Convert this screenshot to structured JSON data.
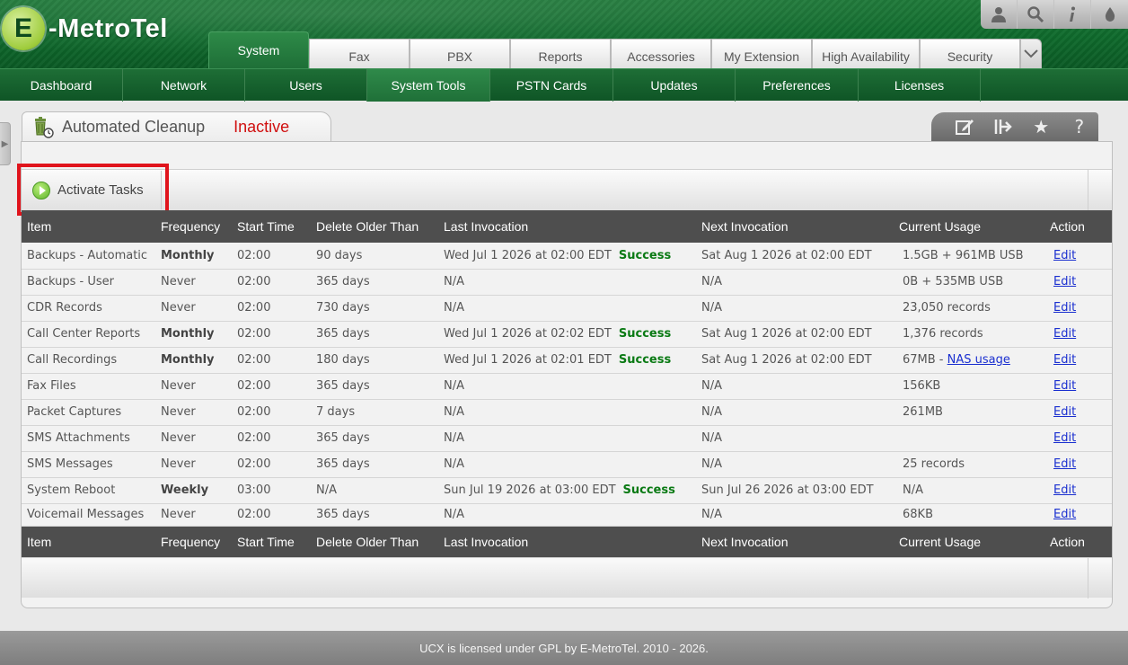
{
  "brand": {
    "logo_letter": "E",
    "logo_text": "-MetroTel"
  },
  "top_icons": [
    "user-icon",
    "search-icon",
    "info-icon",
    "drop-icon"
  ],
  "tabs": [
    {
      "label": "System",
      "active": true
    },
    {
      "label": "Fax"
    },
    {
      "label": "PBX"
    },
    {
      "label": "Reports"
    },
    {
      "label": "Accessories"
    },
    {
      "label": "My Extension"
    },
    {
      "label": "High Availability"
    },
    {
      "label": "Security"
    }
  ],
  "subnav": [
    {
      "label": "Dashboard"
    },
    {
      "label": "Network"
    },
    {
      "label": "Users"
    },
    {
      "label": "System Tools",
      "active": true
    },
    {
      "label": "PSTN Cards"
    },
    {
      "label": "Updates"
    },
    {
      "label": "Preferences"
    },
    {
      "label": "Licenses"
    }
  ],
  "page": {
    "title": "Automated Cleanup",
    "status": "Inactive",
    "status_color": "#d01010"
  },
  "toolbar": {
    "activate_label": "Activate Tasks"
  },
  "table": {
    "headers": [
      "Item",
      "Frequency",
      "Start Time",
      "Delete Older Than",
      "Last Invocation",
      "Next Invocation",
      "Current Usage",
      "Action"
    ],
    "rows": [
      {
        "item": "Backups - Automatic",
        "frequency": "Monthly",
        "freq_bold": true,
        "start": "02:00",
        "older": "90 days",
        "last": "Wed Jul 1 2026 at 02:00 EDT",
        "last_status": "Success",
        "next": "Sat Aug 1 2026 at 02:00 EDT",
        "usage": "1.5GB + 961MB USB",
        "action": "Edit"
      },
      {
        "item": "Backups - User",
        "frequency": "Never",
        "start": "02:00",
        "older": "365 days",
        "last": "N/A",
        "next": "N/A",
        "usage": "0B + 535MB USB",
        "action": "Edit"
      },
      {
        "item": "CDR Records",
        "frequency": "Never",
        "start": "02:00",
        "older": "730 days",
        "last": "N/A",
        "next": "N/A",
        "usage": "23,050 records",
        "action": "Edit"
      },
      {
        "item": "Call Center Reports",
        "frequency": "Monthly",
        "freq_bold": true,
        "start": "02:00",
        "older": "365 days",
        "last": "Wed Jul 1 2026 at 02:02 EDT",
        "last_status": "Success",
        "next": "Sat Aug 1 2026 at 02:00 EDT",
        "usage": "1,376 records",
        "action": "Edit"
      },
      {
        "item": "Call Recordings",
        "frequency": "Monthly",
        "freq_bold": true,
        "start": "02:00",
        "older": "180 days",
        "last": "Wed Jul 1 2026 at 02:01 EDT",
        "last_status": "Success",
        "next": "Sat Aug 1 2026 at 02:00 EDT",
        "usage": "67MB - ",
        "usage_link": "NAS usage",
        "action": "Edit"
      },
      {
        "item": "Fax Files",
        "frequency": "Never",
        "start": "02:00",
        "older": "365 days",
        "last": "N/A",
        "next": "N/A",
        "usage": "156KB",
        "action": "Edit"
      },
      {
        "item": "Packet Captures",
        "frequency": "Never",
        "start": "02:00",
        "older": "7 days",
        "last": "N/A",
        "next": "N/A",
        "usage": "261MB",
        "action": "Edit"
      },
      {
        "item": "SMS Attachments",
        "frequency": "Never",
        "start": "02:00",
        "older": "365 days",
        "last": "N/A",
        "next": "N/A",
        "usage": "",
        "action": "Edit"
      },
      {
        "item": "SMS Messages",
        "frequency": "Never",
        "start": "02:00",
        "older": "365 days",
        "last": "N/A",
        "next": "N/A",
        "usage": "25 records",
        "action": "Edit"
      },
      {
        "item": "System Reboot",
        "frequency": "Weekly",
        "freq_bold": true,
        "start": "03:00",
        "older": "N/A",
        "last": "Sun Jul 19 2026 at 03:00 EDT",
        "last_status": "Success",
        "next": "Sun Jul 26 2026 at 03:00 EDT",
        "usage": "N/A",
        "action": "Edit"
      },
      {
        "item": "Voicemail Messages",
        "frequency": "Never",
        "start": "02:00",
        "older": "365 days",
        "last": "N/A",
        "next": "N/A",
        "usage": "68KB",
        "action": "Edit"
      }
    ]
  },
  "footer": {
    "text": "UCX is licensed under GPL by E-MetroTel. 2010 - 2026."
  }
}
